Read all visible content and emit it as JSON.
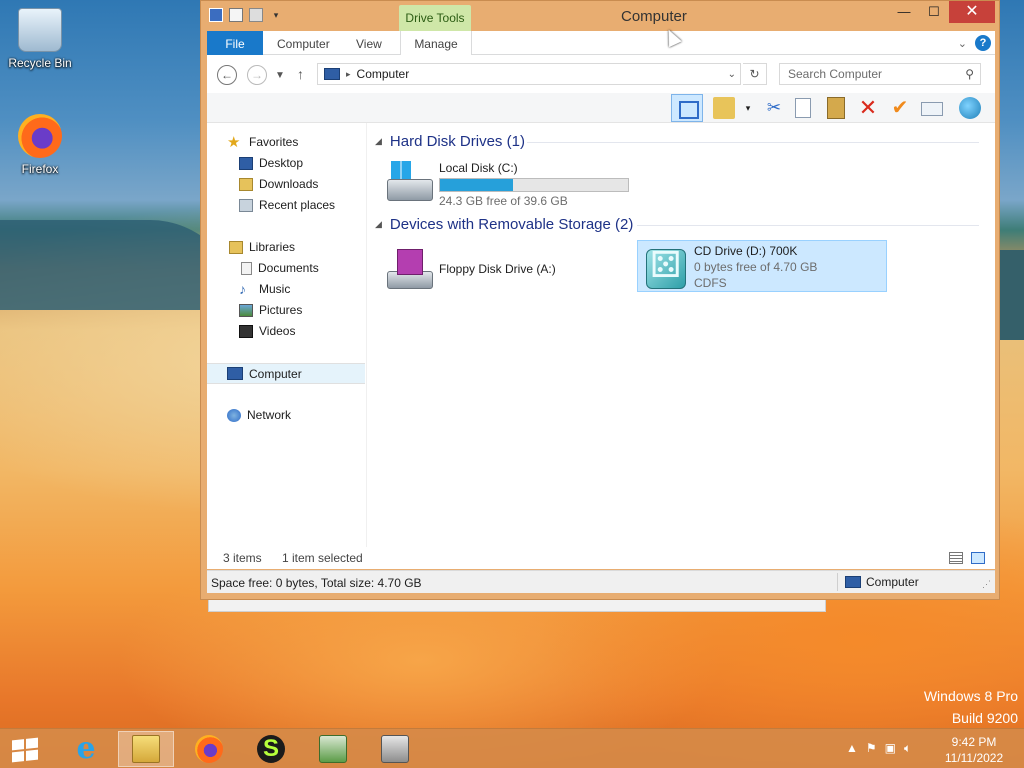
{
  "desktop": {
    "icons": [
      {
        "label": "Recycle Bin"
      },
      {
        "label": "Firefox"
      }
    ],
    "watermark": {
      "line1": "Windows 8 Pro",
      "line2": "Build 9200"
    }
  },
  "window": {
    "title": "Computer",
    "contextual_tab": "Drive Tools",
    "ribbon_tabs": [
      "File",
      "Computer",
      "View",
      "Manage"
    ],
    "address": "Computer",
    "search_placeholder": "Search Computer",
    "nav_pane": {
      "favorites": "Favorites",
      "favorites_items": [
        "Desktop",
        "Downloads",
        "Recent places"
      ],
      "libraries": "Libraries",
      "libraries_items": [
        "Documents",
        "Music",
        "Pictures",
        "Videos"
      ],
      "computer": "Computer",
      "network": "Network"
    },
    "groups": [
      {
        "header": "Hard Disk Drives (1)",
        "drives": [
          {
            "name": "Local Disk (C:)",
            "free": "24.3 GB free of 39.6 GB",
            "used_fraction": 0.386
          }
        ]
      },
      {
        "header": "Devices with Removable Storage (2)",
        "drives": [
          {
            "name": "Floppy Disk Drive (A:)"
          },
          {
            "name": "CD Drive (D:) 700K",
            "free": "0 bytes free of 4.70 GB",
            "fs": "CDFS"
          }
        ]
      }
    ],
    "status": {
      "items": "3 items",
      "selected": "1 item selected"
    },
    "details_bar": {
      "space": "Space free: 0 bytes, Total size: 4.70 GB",
      "location": "Computer"
    }
  },
  "taskbar": {
    "clock_time": "9:42 PM",
    "clock_date": "11/11/2022"
  }
}
